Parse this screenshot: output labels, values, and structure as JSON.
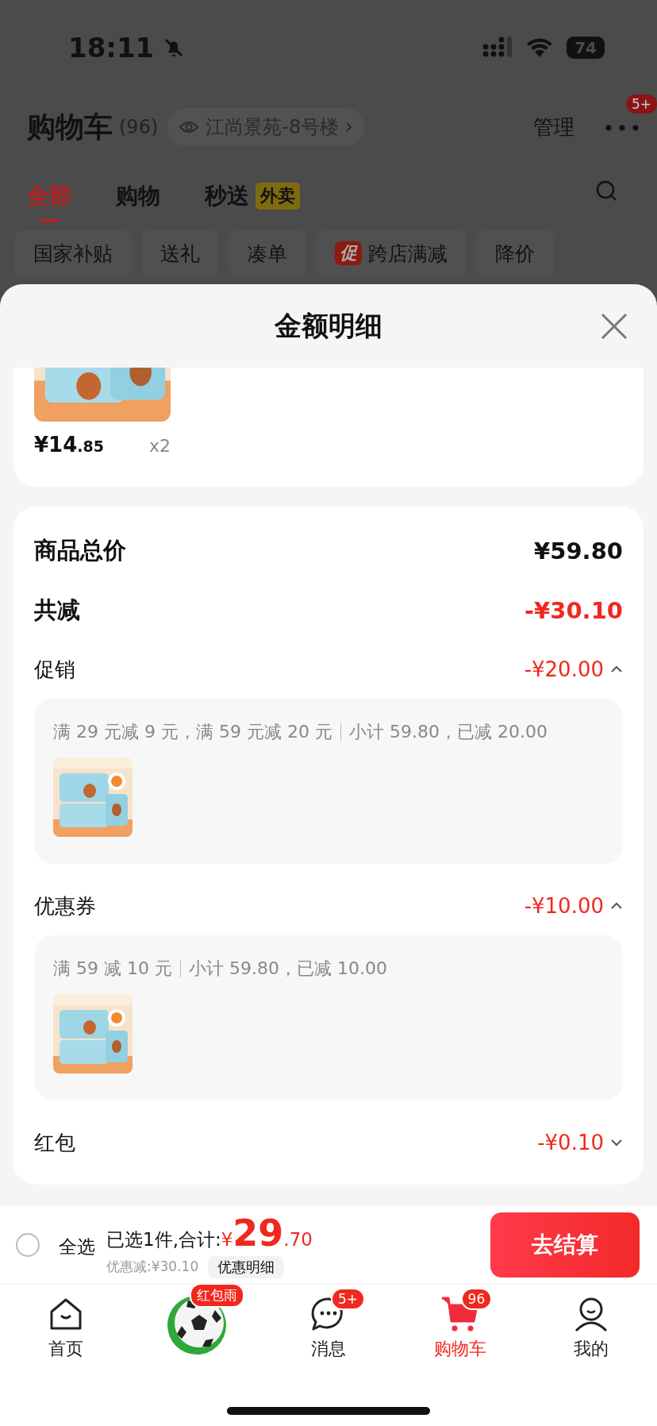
{
  "status_bar": {
    "time": "18:11",
    "battery": "74"
  },
  "header": {
    "title": "购物车",
    "count": "(96)",
    "address": "江尚景苑-8号楼",
    "manage": "管理",
    "more_badge": "5+"
  },
  "tabs": [
    {
      "label": "全部",
      "selected": true
    },
    {
      "label": "购物",
      "selected": false
    },
    {
      "label": "秒送",
      "badge": "外卖",
      "selected": false
    }
  ],
  "filters": [
    {
      "label": "国家补贴"
    },
    {
      "label": "送礼"
    },
    {
      "label": "凑单"
    },
    {
      "label": "跨店满减",
      "tag": "促"
    },
    {
      "label": "降价"
    }
  ],
  "sheet": {
    "title": "金额明细",
    "item": {
      "price_int": "¥14",
      "price_dec": ".85",
      "qty": "x2"
    },
    "summary": [
      {
        "label": "商品总价",
        "value": "¥59.80",
        "kind": "total"
      },
      {
        "label": "共减",
        "value": "-¥30.10",
        "kind": "discount"
      }
    ],
    "sections": [
      {
        "label": "促销",
        "value": "-¥20.00",
        "expanded": true,
        "rule": "满 29 元减 9 元，满 59 元减 20 元",
        "subtotal": "小计 59.80，已减 20.00"
      },
      {
        "label": "优惠券",
        "value": "-¥10.00",
        "expanded": true,
        "rule": "满 59 减 10 元",
        "subtotal": "小计 59.80，已减 10.00"
      },
      {
        "label": "红包",
        "value": "-¥0.10",
        "expanded": false
      }
    ]
  },
  "checkout": {
    "select_all": {
      "label": "全选",
      "checked": false
    },
    "summary": "已选1件,合计:",
    "currency": "¥",
    "price_int": "29",
    "price_dec": ".70",
    "saving": "优惠减:¥30.10",
    "detail_button": "优惠明细",
    "button": "去结算"
  },
  "nav": [
    {
      "label": "首页",
      "selected": false
    },
    {
      "badge": "红包雨"
    },
    {
      "label": "消息",
      "badge": "5+",
      "selected": false
    },
    {
      "label": "购物车",
      "badge": "96",
      "selected": true
    },
    {
      "label": "我的",
      "selected": false
    }
  ]
}
